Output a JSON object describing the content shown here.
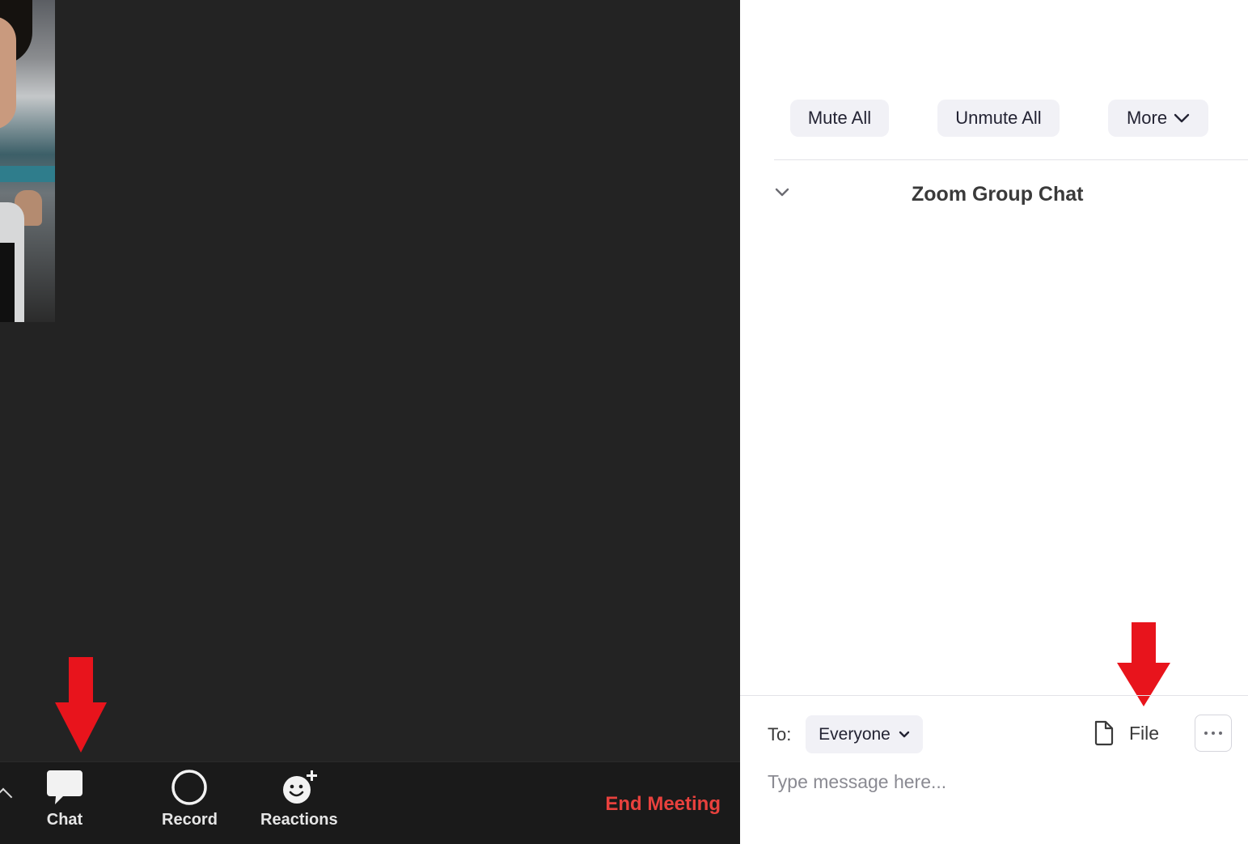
{
  "toolbar": {
    "chat_label": "Chat",
    "record_label": "Record",
    "reactions_label": "Reactions",
    "end_meeting_label": "End Meeting"
  },
  "panel": {
    "mute_all_label": "Mute All",
    "unmute_all_label": "Unmute All",
    "more_label": "More",
    "group_chat_title": "Zoom Group Chat",
    "to_label": "To:",
    "to_selected": "Everyone",
    "file_label": "File",
    "message_placeholder": "Type message here..."
  },
  "icons": {
    "chat": "chat-bubble-icon",
    "record": "record-circle-icon",
    "reactions": "smiley-plus-icon",
    "expand": "chevron-up-icon",
    "more_chevron": "chevron-down-icon",
    "group_chevron": "chevron-down-icon",
    "to_chevron": "chevron-down-icon",
    "file": "file-icon",
    "ellipsis": "ellipsis-icon",
    "annotation": "red-down-arrow-icon"
  },
  "colors": {
    "meeting_background": "#232323",
    "toolbar_background": "#1a1a1a",
    "end_meeting": "#e8413d",
    "annotation_arrow": "#e8141c",
    "pill_background": "#f1f1f6"
  }
}
